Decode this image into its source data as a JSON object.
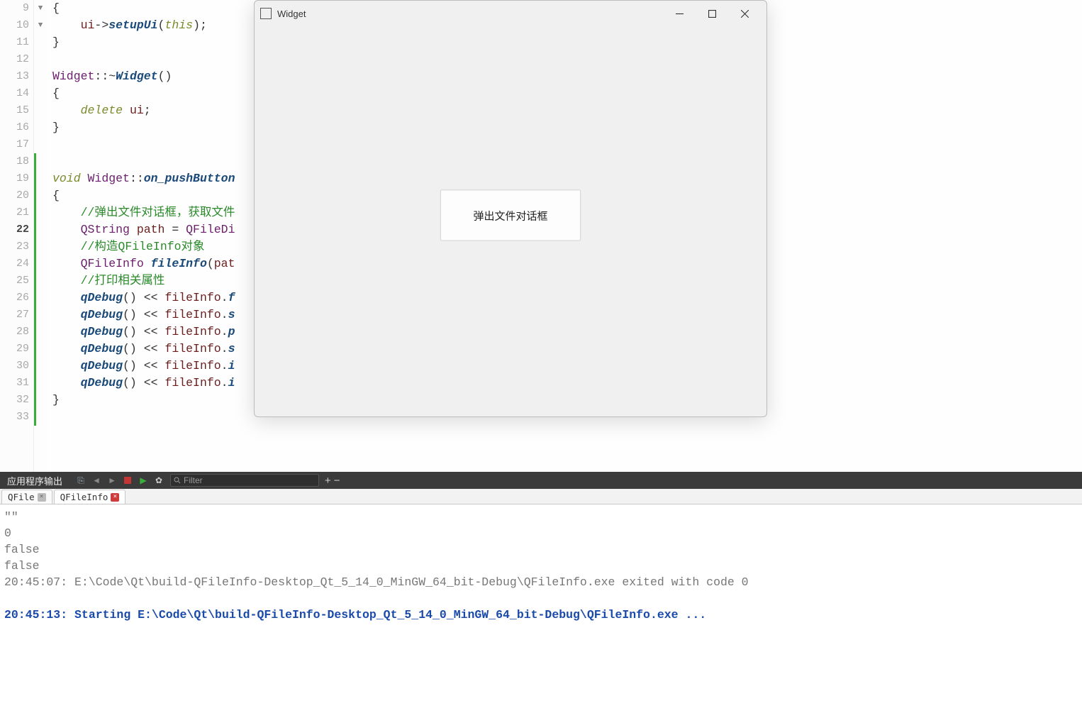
{
  "editor": {
    "lines": [
      {
        "n": 9,
        "fold": "",
        "html": "{"
      },
      {
        "n": 10,
        "fold": "",
        "html": "    <span class='id'>ui</span>-><span class='func'>setupUi</span>(<span class='kw'>this</span>);"
      },
      {
        "n": 11,
        "fold": "",
        "html": "}"
      },
      {
        "n": 12,
        "fold": "",
        "html": ""
      },
      {
        "n": 13,
        "fold": "▼",
        "html": "<span class='type'>Widget</span>::~<span class='func'>Widget</span>()"
      },
      {
        "n": 14,
        "fold": "",
        "html": "{"
      },
      {
        "n": 15,
        "fold": "",
        "html": "    <span class='kw'>delete</span> <span class='id'>ui</span>;"
      },
      {
        "n": 16,
        "fold": "",
        "html": "}"
      },
      {
        "n": 17,
        "fold": "",
        "html": ""
      },
      {
        "n": 18,
        "fold": "",
        "html": "",
        "mod": true
      },
      {
        "n": 19,
        "fold": "▼",
        "html": "<span class='kw'>void</span> <span class='type'>Widget</span>::<span class='func'>on_pushButton</span>",
        "mod": true
      },
      {
        "n": 20,
        "fold": "",
        "html": "{",
        "mod": true
      },
      {
        "n": 21,
        "fold": "",
        "html": "    <span class='cmt'>//弹出文件对话框，获取文件</span>",
        "mod": true
      },
      {
        "n": 22,
        "fold": "",
        "html": "    <span class='type'>QString</span> <span class='id'>path</span> = <span class='type'>QFileDi</span>",
        "mod": true,
        "cur": true
      },
      {
        "n": 23,
        "fold": "",
        "html": "    <span class='cmt'>//构造QFileInfo对象</span>",
        "mod": true
      },
      {
        "n": 24,
        "fold": "",
        "html": "    <span class='type'>QFileInfo</span> <span class='func'>fileInfo</span>(<span class='id'>pat</span>",
        "mod": true
      },
      {
        "n": 25,
        "fold": "",
        "html": "    <span class='cmt'>//打印相关属性</span>",
        "mod": true
      },
      {
        "n": 26,
        "fold": "",
        "html": "    <span class='func'>qDebug</span>() &lt;&lt; <span class='id'>fileInfo</span>.<span class='func'>f</span>",
        "mod": true
      },
      {
        "n": 27,
        "fold": "",
        "html": "    <span class='func'>qDebug</span>() &lt;&lt; <span class='id'>fileInfo</span>.<span class='func'>s</span>",
        "mod": true
      },
      {
        "n": 28,
        "fold": "",
        "html": "    <span class='func'>qDebug</span>() &lt;&lt; <span class='id'>fileInfo</span>.<span class='func'>p</span>",
        "mod": true
      },
      {
        "n": 29,
        "fold": "",
        "html": "    <span class='func'>qDebug</span>() &lt;&lt; <span class='id'>fileInfo</span>.<span class='func'>s</span>",
        "mod": true
      },
      {
        "n": 30,
        "fold": "",
        "html": "    <span class='func'>qDebug</span>() &lt;&lt; <span class='id'>fileInfo</span>.<span class='func'>i</span>",
        "mod": true
      },
      {
        "n": 31,
        "fold": "",
        "html": "    <span class='func'>qDebug</span>() &lt;&lt; <span class='id'>fileInfo</span>.<span class='func'>i</span>",
        "mod": true
      },
      {
        "n": 32,
        "fold": "",
        "html": "}",
        "mod": true
      },
      {
        "n": 33,
        "fold": "",
        "html": "",
        "mod": true
      }
    ]
  },
  "widget_window": {
    "title": "Widget",
    "button_label": "弹出文件对话框"
  },
  "output": {
    "panel_title": "应用程序输出",
    "filter_placeholder": "Filter",
    "tabs": [
      {
        "label": "QFile",
        "active": false,
        "close": "gray"
      },
      {
        "label": "QFileInfo",
        "active": true,
        "close": "red"
      }
    ],
    "lines": [
      {
        "text": "\"\"",
        "cls": ""
      },
      {
        "text": "0",
        "cls": ""
      },
      {
        "text": "false",
        "cls": ""
      },
      {
        "text": "false",
        "cls": ""
      },
      {
        "text": "20:45:07: E:\\Code\\Qt\\build-QFileInfo-Desktop_Qt_5_14_0_MinGW_64_bit-Debug\\QFileInfo.exe exited with code 0",
        "cls": "ts"
      },
      {
        "text": "",
        "cls": ""
      },
      {
        "text": "20:45:13: Starting E:\\Code\\Qt\\build-QFileInfo-Desktop_Qt_5_14_0_MinGW_64_bit-Debug\\QFileInfo.exe ...",
        "cls": "blue"
      }
    ]
  }
}
